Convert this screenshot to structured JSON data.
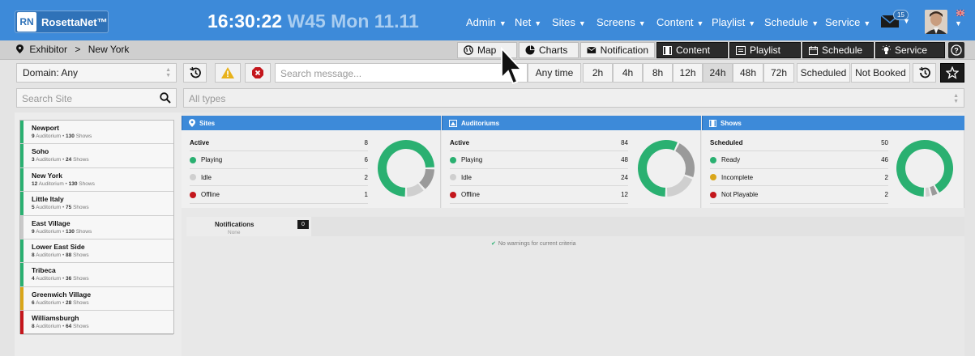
{
  "app": {
    "logo_abbr": "RN",
    "name": "RosettaNet™"
  },
  "clock": {
    "time": "16:30:22",
    "date": "W45 Mon 11.11"
  },
  "nav": [
    {
      "label": "Admin"
    },
    {
      "label": "Net"
    },
    {
      "label": "Sites"
    },
    {
      "label": "Screens"
    },
    {
      "label": "Content"
    },
    {
      "label": "Playlist"
    },
    {
      "label": "Schedule"
    },
    {
      "label": "Service"
    }
  ],
  "header": {
    "mail_count": "15",
    "mail_icon": "envelope-icon",
    "flag_icon": "uk-flag-icon"
  },
  "breadcrumb": {
    "root": "Exhibitor",
    "separator": ">",
    "current": "New York"
  },
  "modules": [
    {
      "label": "Map",
      "icon": "globe-icon"
    },
    {
      "label": "Charts",
      "icon": "pie-chart-icon"
    },
    {
      "label": "Notification",
      "icon": "envelope-icon"
    },
    {
      "label": "Content",
      "icon": "film-icon"
    },
    {
      "label": "Playlist",
      "icon": "playlist-icon"
    },
    {
      "label": "Schedule",
      "icon": "calendar-icon"
    },
    {
      "label": "Service",
      "icon": "lightbulb-icon"
    }
  ],
  "filters": {
    "domain": "Domain: Any",
    "search_message_placeholder": "Search message...",
    "search_site_placeholder": "Search Site",
    "types": "All types",
    "time_ranges": [
      "Any time",
      "2h",
      "4h",
      "8h",
      "12h",
      "24h",
      "48h",
      "72h",
      "Scheduled",
      "Not Booked"
    ],
    "active_range": "24h"
  },
  "sites": [
    {
      "name": "Newport",
      "auditoriums": "9",
      "shows": "130",
      "status_color": "#2ab071"
    },
    {
      "name": "Soho",
      "auditoriums": "3",
      "shows": "24",
      "status_color": "#2ab071"
    },
    {
      "name": "New York",
      "auditoriums": "12",
      "shows": "130",
      "status_color": "#2ab071"
    },
    {
      "name": "Little Italy",
      "auditoriums": "5",
      "shows": "75",
      "status_color": "#2ab071"
    },
    {
      "name": "East Village",
      "auditoriums": "9",
      "shows": "130",
      "status_color": "#c9c9c9"
    },
    {
      "name": "Lower East Side",
      "auditoriums": "8",
      "shows": "88",
      "status_color": "#2ab071"
    },
    {
      "name": "Tribeca",
      "auditoriums": "4",
      "shows": "36",
      "status_color": "#2ab071"
    },
    {
      "name": "Greenwich Village",
      "auditoriums": "6",
      "shows": "28",
      "status_color": "#d9a61a"
    },
    {
      "name": "Williamsburgh",
      "auditoriums": "8",
      "shows": "64",
      "status_color": "#c4161c"
    }
  ],
  "site_meta": {
    "auditorium_word": "Auditorium",
    "bullet": "•",
    "shows_word": "Shows"
  },
  "panels": [
    {
      "title": "Sites",
      "icon": "map-pin-icon",
      "rows": [
        {
          "label": "Active",
          "value": 8,
          "dot": ""
        },
        {
          "label": "Playing",
          "value": 6,
          "dot": "#2ab071"
        },
        {
          "label": "Idle",
          "value": 2,
          "dot": "#cfcfcf"
        },
        {
          "label": "Offline",
          "value": 1,
          "dot": "#c4161c"
        }
      ]
    },
    {
      "title": "Auditoriums",
      "icon": "auditorium-icon",
      "rows": [
        {
          "label": "Active",
          "value": 84,
          "dot": ""
        },
        {
          "label": "Playing",
          "value": 48,
          "dot": "#2ab071"
        },
        {
          "label": "Idle",
          "value": 24,
          "dot": "#cfcfcf"
        },
        {
          "label": "Offline",
          "value": 12,
          "dot": "#c4161c"
        }
      ]
    },
    {
      "title": "Shows",
      "icon": "film-icon",
      "rows": [
        {
          "label": "Scheduled",
          "value": 50,
          "dot": ""
        },
        {
          "label": "Ready",
          "value": 46,
          "dot": "#2ab071"
        },
        {
          "label": "Incomplete",
          "value": 2,
          "dot": "#d9a61a"
        },
        {
          "label": "Not Playable",
          "value": 2,
          "dot": "#c4161c"
        }
      ]
    }
  ],
  "notifications": {
    "label": "Notifications",
    "count": "0",
    "subtitle": "None",
    "empty_message": "No warnings for current criteria"
  },
  "colors": {
    "accent": "#3d8ad9",
    "ok": "#2ab071",
    "warn": "#d9a61a",
    "error": "#c4161c",
    "idle": "#cfcfcf",
    "donut_rest": "#a9a9a9"
  }
}
